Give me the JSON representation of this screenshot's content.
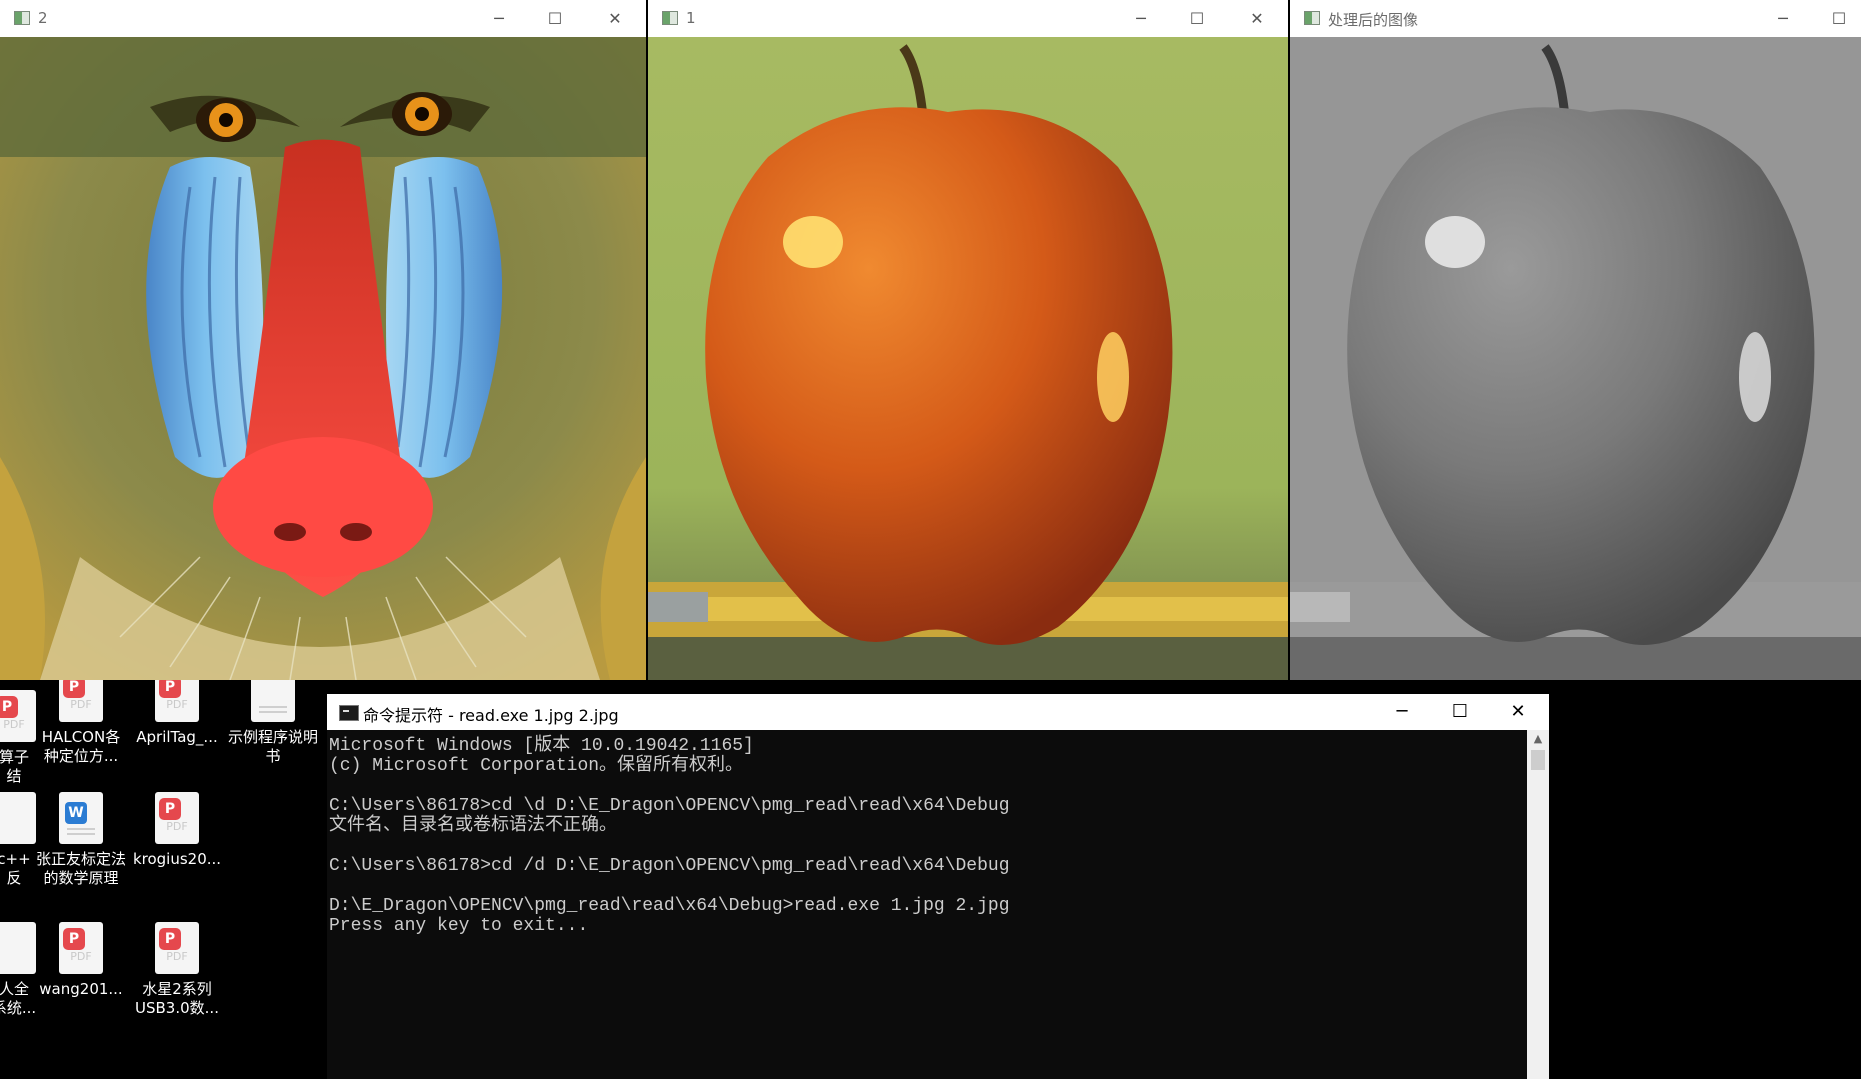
{
  "desktop": {
    "icons": [
      {
        "label": "算子\n结"
      },
      {
        "label": "HALCON各\n种定位方..."
      },
      {
        "label": "AprilTag_..."
      },
      {
        "label": "示例程序说明\n书"
      },
      {
        "label": "c++\n反"
      },
      {
        "label": "张正友标定法\n的数学原理"
      },
      {
        "label": "krogius20..."
      },
      {
        "label": "人全\n系统..."
      },
      {
        "label": "wang201..."
      },
      {
        "label": "水星2系列\nUSB3.0数..."
      }
    ],
    "pdf_mark": "PDF"
  },
  "windows": [
    {
      "title": "2",
      "image": "mandrill-color-image"
    },
    {
      "title": "1",
      "image": "apple-color-image"
    },
    {
      "title": "处理后的图像",
      "image": "apple-grayscale-image"
    }
  ],
  "window_controls": {
    "minimize": "─",
    "maximize": "☐",
    "close": "✕"
  },
  "cmd": {
    "title": "命令提示符 - read.exe  1.jpg 2.jpg",
    "lines": "Microsoft Windows [版本 10.0.19042.1165]\n(c) Microsoft Corporation。保留所有权利。\n\nC:\\Users\\86178>cd \\d D:\\E_Dragon\\OPENCV\\pmg_read\\read\\x64\\Debug\n文件名、目录名或卷标语法不正确。\n\nC:\\Users\\86178>cd /d D:\\E_Dragon\\OPENCV\\pmg_read\\read\\x64\\Debug\n\nD:\\E_Dragon\\OPENCV\\pmg_read\\read\\x64\\Debug>read.exe 1.jpg 2.jpg\nPress any key to exit..."
  }
}
